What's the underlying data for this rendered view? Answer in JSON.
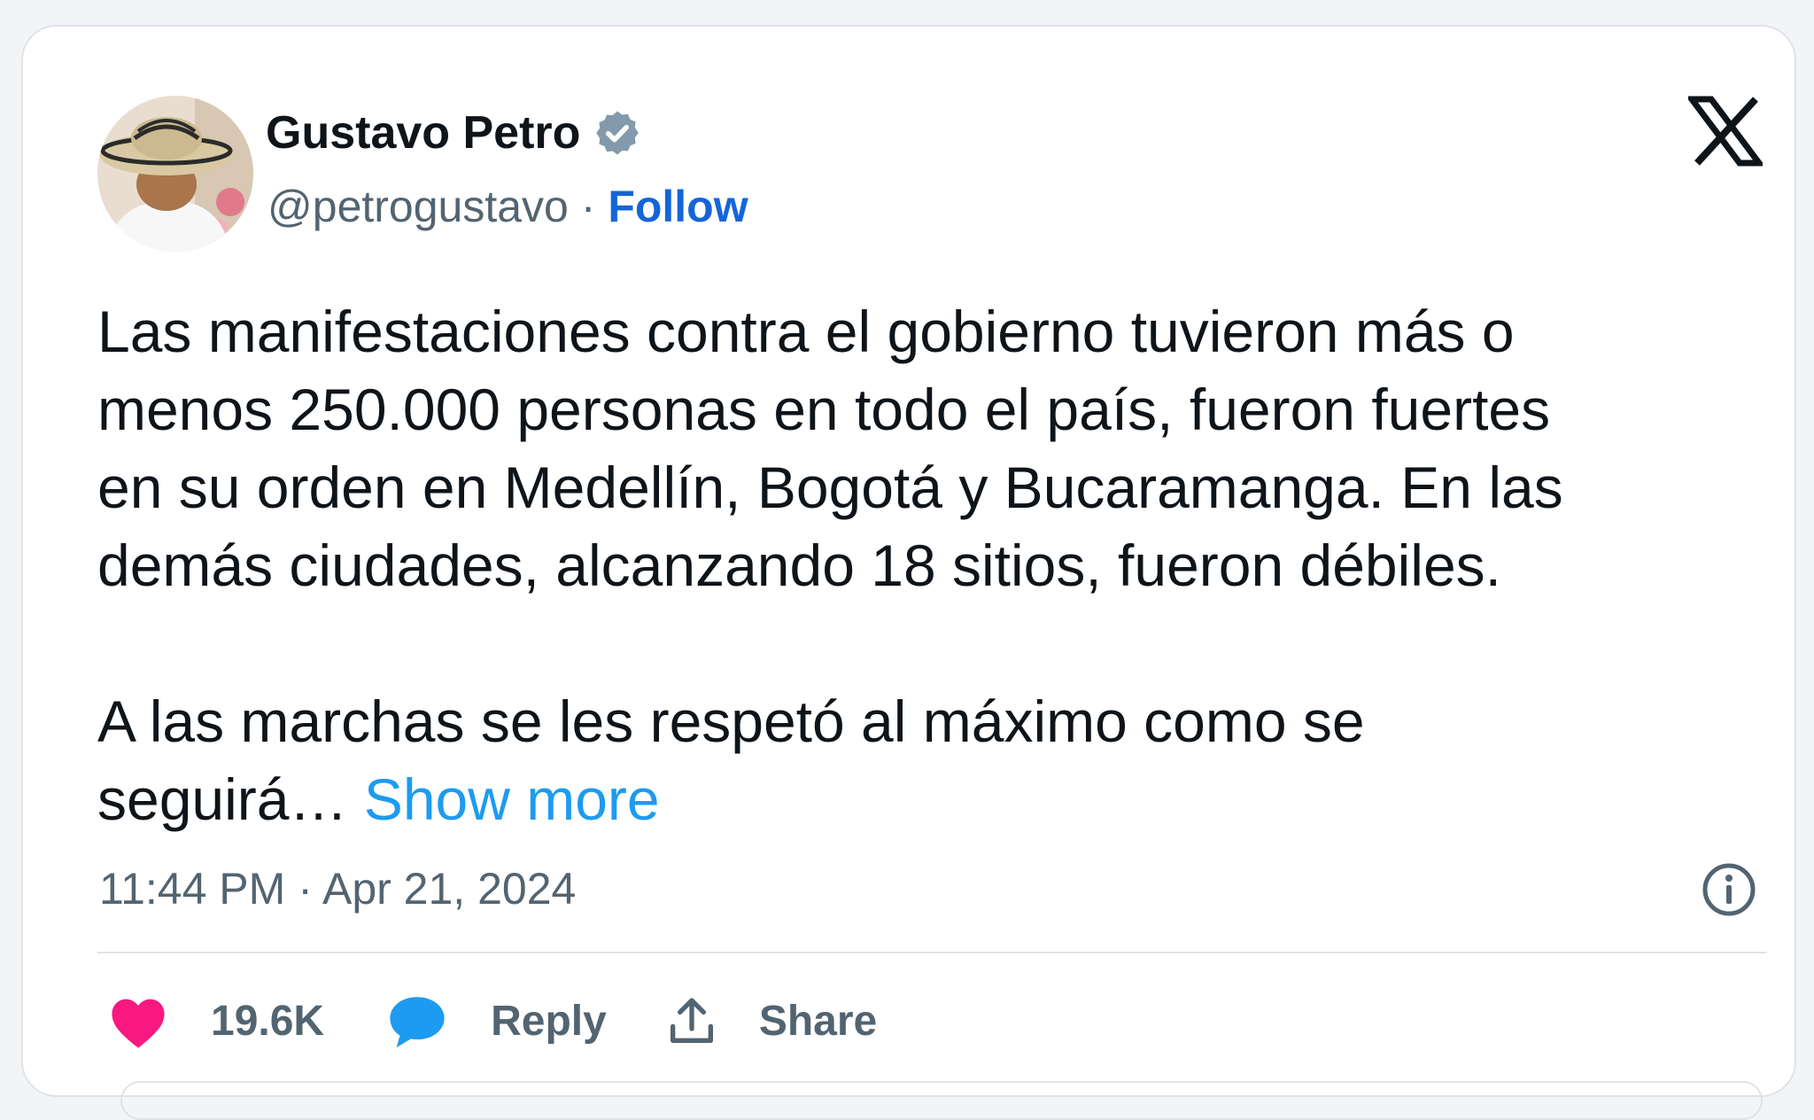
{
  "author": {
    "name": "Gustavo Petro",
    "handle": "@petrogustavo",
    "separator": "·",
    "follow_label": "Follow"
  },
  "tweet": {
    "text": "Las manifestaciones contra el gobierno tuvieron más o\nmenos 250.000 personas en todo el país, fueron fuertes\nen su orden en Medellín, Bogotá y Bucaramanga. En las\ndemás ciudades, alcanzando 18 sitios, fueron débiles.\n\nA las marchas se les respetó al máximo como se\nseguirá… ",
    "show_more_label": "Show more",
    "timestamp": "11:44 PM · Apr 21, 2024"
  },
  "actions": {
    "like_count": "19.6K",
    "reply_label": "Reply",
    "share_label": "Share"
  },
  "icons": {
    "verified": "verified-badge-icon",
    "platform_logo": "x-logo-icon",
    "info": "info-icon",
    "like": "heart-icon",
    "reply": "speech-bubble-icon",
    "share": "share-upload-icon"
  },
  "colors": {
    "like": "#f91880",
    "reply": "#1d9bf0",
    "follow": "#1565d8",
    "show_more": "#1d9bf0",
    "secondary_text": "#536471",
    "verified_badge": "#829aab"
  }
}
